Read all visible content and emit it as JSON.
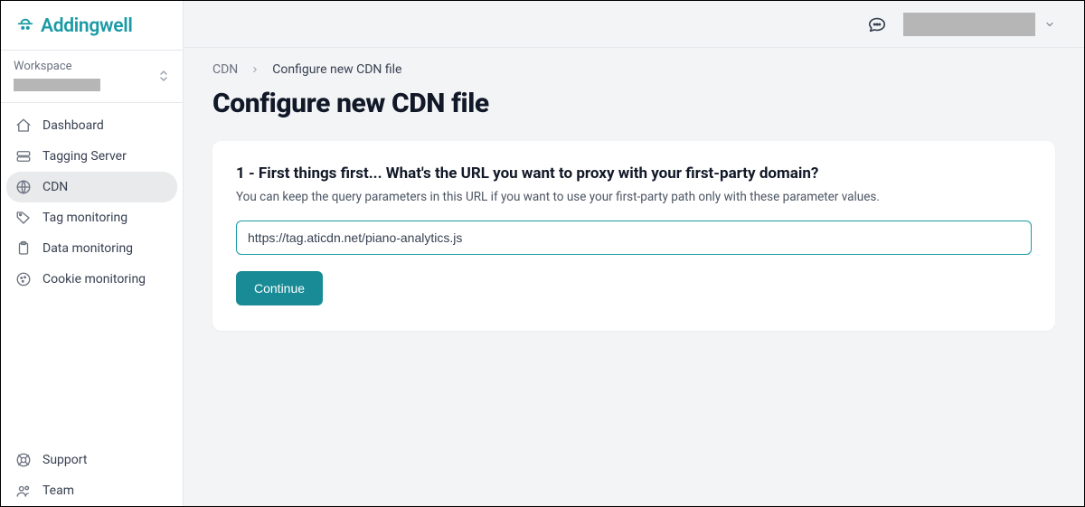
{
  "brand": {
    "name": "Addingwell"
  },
  "workspace": {
    "label": "Workspace"
  },
  "sidebar": {
    "items": [
      {
        "label": "Dashboard",
        "icon": "home-icon",
        "active": false
      },
      {
        "label": "Tagging Server",
        "icon": "server-icon",
        "active": false
      },
      {
        "label": "CDN",
        "icon": "globe-icon",
        "active": true
      },
      {
        "label": "Tag monitoring",
        "icon": "tag-icon",
        "active": false
      },
      {
        "label": "Data monitoring",
        "icon": "clipboard-icon",
        "active": false
      },
      {
        "label": "Cookie monitoring",
        "icon": "cookie-icon",
        "active": false
      }
    ],
    "bottom": [
      {
        "label": "Support",
        "icon": "support-icon"
      },
      {
        "label": "Team",
        "icon": "team-icon"
      }
    ]
  },
  "breadcrumb": {
    "root": "CDN",
    "current": "Configure new CDN file"
  },
  "page": {
    "title": "Configure new CDN file"
  },
  "form": {
    "step_heading": "1 - First things first... What's the URL you want to proxy with your first-party domain?",
    "step_sub": "You can keep the query parameters in this URL if you want to use your first-party path only with these parameter values.",
    "url_value": "https://tag.aticdn.net/piano-analytics.js",
    "continue_label": "Continue"
  }
}
